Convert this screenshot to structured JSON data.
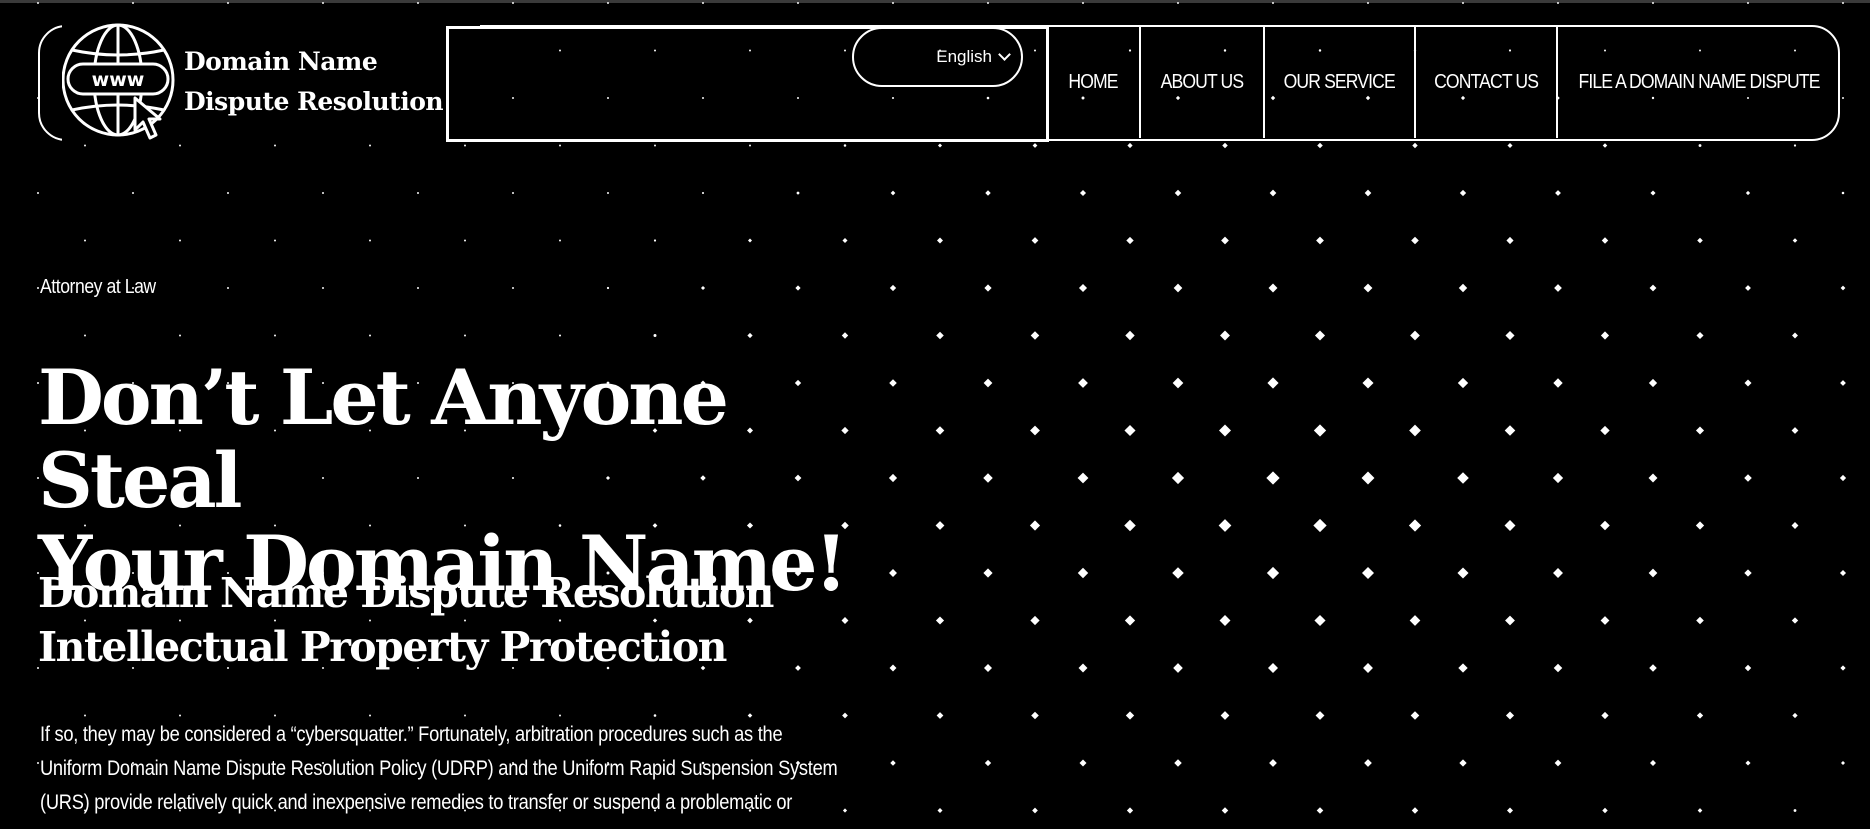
{
  "brand": {
    "line1": "Domain Name",
    "line2": "Dispute Resolution",
    "logo_icon": "www-globe-cursor-icon"
  },
  "language": {
    "selected": "English",
    "icon": "chevron-down-icon"
  },
  "nav": {
    "items": [
      {
        "label": "HOME"
      },
      {
        "label": "ABOUT US"
      },
      {
        "label": "OUR SERVICE"
      },
      {
        "label": "CONTACT US"
      },
      {
        "label": "FILE A DOMAIN NAME DISPUTE"
      }
    ]
  },
  "hero": {
    "eyebrow": "Attorney at Law",
    "title_line1": "Don’t Let Anyone Steal",
    "title_line2": "Your Domain Name!",
    "subtitle_line1": "Domain Name Dispute Resolution",
    "subtitle_line2": "Intellectual Property Protection",
    "body_lines": [
      "If so, they may be considered a “cybersquatter.” Fortunately, arbitration procedures such as the",
      "Uniform Domain Name Dispute Resolution Policy (UDRP) and the Uniform Rapid Suspension System",
      "(URS) provide relatively quick and inexpensive remedies to transfer or suspend a problematic or"
    ]
  },
  "colors": {
    "background": "#000000",
    "foreground": "#ffffff"
  }
}
